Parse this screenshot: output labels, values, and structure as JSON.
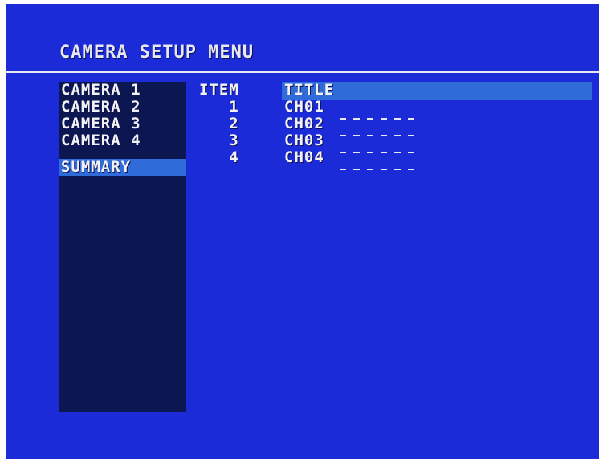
{
  "menu": {
    "title": "CAMERA SETUP MENU"
  },
  "sidebar": {
    "items": [
      {
        "label": "CAMERA 1"
      },
      {
        "label": "CAMERA 2"
      },
      {
        "label": "CAMERA 3"
      },
      {
        "label": "CAMERA 4"
      },
      {
        "label": "SUMMARY",
        "selected": true
      }
    ]
  },
  "table": {
    "headers": {
      "item": "ITEM",
      "title": "TITLE"
    },
    "rows": [
      {
        "item": "1",
        "title": "CH01"
      },
      {
        "item": "2",
        "title": "CH02"
      },
      {
        "item": "3",
        "title": "CH03"
      },
      {
        "item": "4",
        "title": "CH04"
      }
    ]
  },
  "colors": {
    "background": "#1b2bd8",
    "sidebar": "#0c1650",
    "highlight": "#2f6bd9",
    "text": "#f2f2f2"
  }
}
